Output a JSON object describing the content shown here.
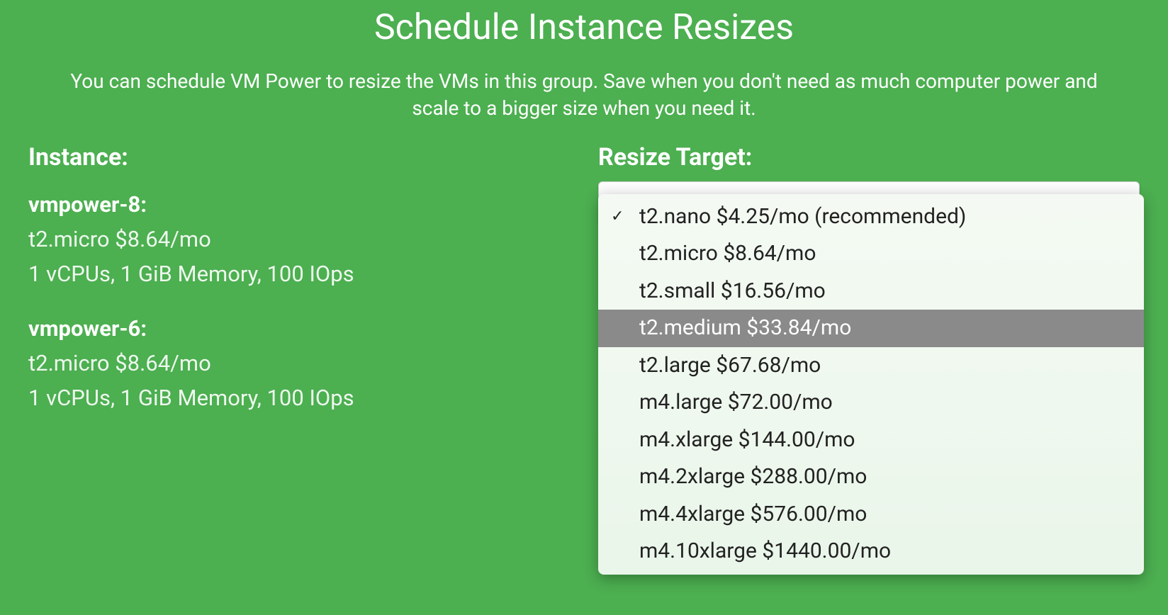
{
  "header": {
    "title": "Schedule Instance Resizes",
    "description": "You can schedule VM Power to resize the VMs in this group. Save when you don't need as much computer power and scale to a bigger size when you need it."
  },
  "left": {
    "label": "Instance:",
    "instances": [
      {
        "name": "vmpower-8:",
        "type": "t2.micro $8.64/mo",
        "specs": "1 vCPUs, 1 GiB Memory, 100 IOps"
      },
      {
        "name": "vmpower-6:",
        "type": "t2.micro $8.64/mo",
        "specs": "1 vCPUs, 1 GiB Memory, 100 IOps"
      }
    ]
  },
  "right": {
    "label": "Resize Target:",
    "selected_index": 0,
    "highlighted_index": 3,
    "options": [
      "t2.nano $4.25/mo (recommended)",
      "t2.micro $8.64/mo",
      "t2.small $16.56/mo",
      "t2.medium $33.84/mo",
      "t2.large $67.68/mo",
      "m4.large $72.00/mo",
      "m4.xlarge $144.00/mo",
      "m4.2xlarge $288.00/mo",
      "m4.4xlarge $576.00/mo",
      "m4.10xlarge $1440.00/mo"
    ]
  }
}
